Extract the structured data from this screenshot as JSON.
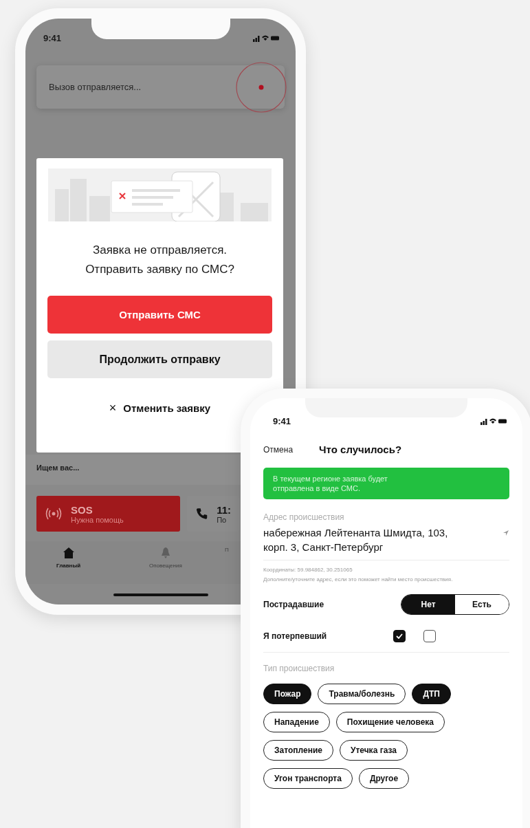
{
  "phone_back": {
    "status_bar": {
      "time": "9:41"
    },
    "sending_card": {
      "text": "Вызов отправляется..."
    },
    "dialog": {
      "message_lines": [
        "Заявка не отправляется.",
        "Отправить заявку по СМС?"
      ],
      "primary_button": "Отправить СМС",
      "secondary_button": "Продолжить отправку",
      "cancel_icon": "×",
      "cancel_button": "Отменить заявку"
    },
    "search_panel": {
      "text": "Ищем вас..."
    },
    "sos_card": {
      "title": "SOS",
      "subtitle": "Нужна помощь"
    },
    "call_card": {
      "title": "11:",
      "subtitle": "По"
    },
    "tab_bar": [
      {
        "label": "Главный",
        "selected": true
      },
      {
        "label": "Оповещения",
        "selected": false
      },
      {
        "label": "П",
        "selected": false
      }
    ]
  },
  "phone_front": {
    "status_bar": {
      "time": "9:41"
    },
    "nav": {
      "cancel": "Отмена",
      "title": "Что случилось?"
    },
    "notice": "В текущем регионе заявка будет отправлена в виде СМС.",
    "address": {
      "label": "Адрес происшествия",
      "value": "набережная Лейтенанта Шмидта, 103, корп. 3, Санкт-Петербург",
      "coordinates": "Координаты: 59.984862, 30.251065",
      "hint": "Дополните/уточните адрес, если это поможет найти место происшествия."
    },
    "victims": {
      "label": "Пострадавшие",
      "options": [
        {
          "label": "Нет",
          "selected": true
        },
        {
          "label": "Есть",
          "selected": false
        }
      ]
    },
    "self_victim": {
      "label": "Я потерпевший",
      "checkboxes": [
        {
          "checked": true
        },
        {
          "checked": false
        }
      ]
    },
    "incident_type": {
      "label": "Тип происшествия",
      "chips": [
        {
          "label": "Пожар",
          "selected": true
        },
        {
          "label": "Травма/болезнь",
          "selected": false
        },
        {
          "label": "ДТП",
          "selected": true
        },
        {
          "label": "Нападение",
          "selected": false
        },
        {
          "label": "Похищение человека",
          "selected": false
        },
        {
          "label": "Затопление",
          "selected": false
        },
        {
          "label": "Утечка газа",
          "selected": false
        },
        {
          "label": "Угон транспорта",
          "selected": false
        },
        {
          "label": "Другое",
          "selected": false
        }
      ]
    }
  }
}
